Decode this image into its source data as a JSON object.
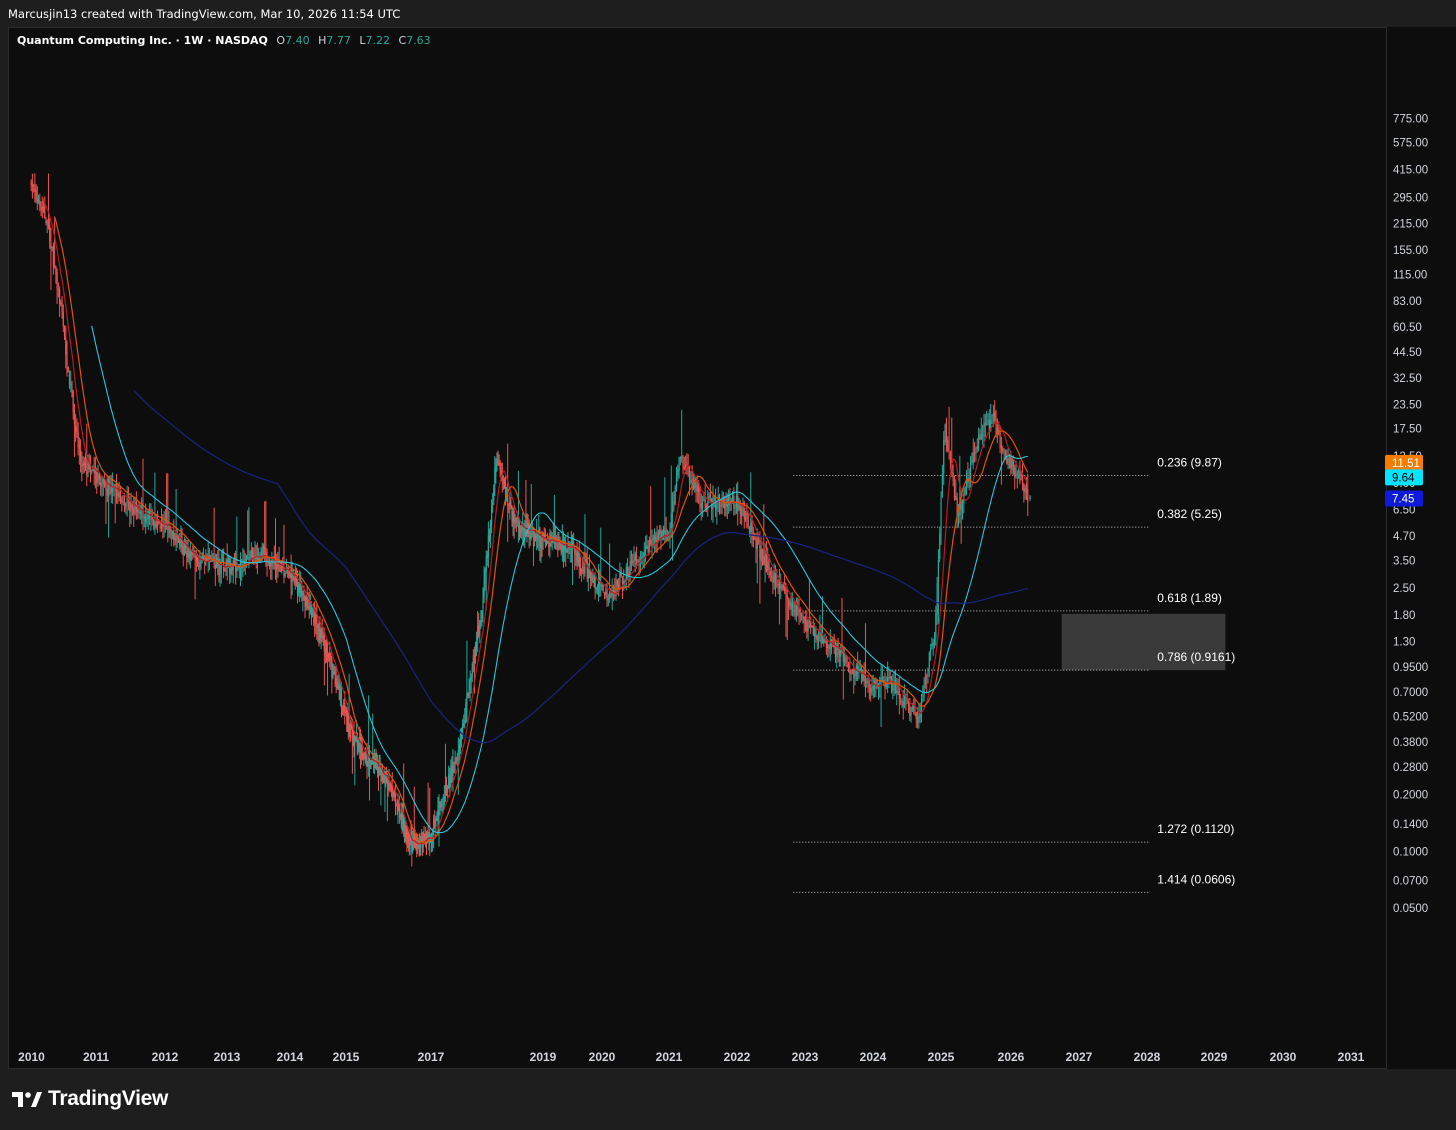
{
  "header": {
    "attribution": "Marcusjin13 created with TradingView.com, Mar 10, 2026 11:54 UTC"
  },
  "legend": {
    "symbol": "Quantum Computing Inc. · 1W · NASDAQ",
    "o_label": "O",
    "o_value": "7.40",
    "h_label": "H",
    "h_value": "7.77",
    "l_label": "L",
    "l_value": "7.22",
    "c_label": "C",
    "c_value": "7.63"
  },
  "brand": {
    "name": "TradingView",
    "logo_icon": "tradingview-logo-icon"
  },
  "colors": {
    "bull": "#26a69a",
    "bear": "#ef5350",
    "ma_fast": "#b71c1c",
    "ma_mid": "#e65100",
    "ma_slow": "#26c6da",
    "ma_long": "#1a237e",
    "badge_orange": "#f57c00",
    "badge_cyan": "#00e5ff",
    "badge_blue": "#0d1bd9"
  },
  "chart_data": {
    "type": "candlestick",
    "title": "Quantum Computing Inc. · 1W · NASDAQ",
    "interval": "1W",
    "y_scale": "log",
    "grid": false,
    "x_ticks": [
      "2010",
      "2011",
      "2012",
      "2013",
      "2014",
      "2015",
      "2017",
      "2019",
      "2020",
      "2021",
      "2022",
      "2023",
      "2024",
      "2025",
      "2026",
      "2027",
      "2028",
      "2029",
      "2030",
      "2031"
    ],
    "y_ticks": [
      "775.00",
      "575.00",
      "415.00",
      "295.00",
      "215.00",
      "155.00",
      "115.00",
      "83.00",
      "60.50",
      "44.50",
      "32.50",
      "23.50",
      "17.50",
      "12.50",
      "9.00",
      "6.50",
      "4.70",
      "3.50",
      "2.50",
      "1.80",
      "1.30",
      "0.9500",
      "0.7000",
      "0.5200",
      "0.3800",
      "0.2800",
      "0.2000",
      "0.1400",
      "0.1000",
      "0.0700",
      "0.0500"
    ],
    "last_ohlc": {
      "open": 7.4,
      "high": 7.77,
      "low": 7.22,
      "close": 7.63
    },
    "price_path": [
      [
        "2009-12-01",
        350
      ],
      [
        "2010-03-01",
        220
      ],
      [
        "2010-06-01",
        60
      ],
      [
        "2010-09-01",
        12
      ],
      [
        "2011-01-01",
        9
      ],
      [
        "2011-06-01",
        7
      ],
      [
        "2012-01-01",
        5
      ],
      [
        "2012-06-01",
        3.5
      ],
      [
        "2013-01-01",
        3.2
      ],
      [
        "2013-06-01",
        3.8
      ],
      [
        "2014-01-01",
        2.8
      ],
      [
        "2014-06-01",
        1.6
      ],
      [
        "2015-01-01",
        0.45
      ],
      [
        "2015-06-01",
        0.32
      ],
      [
        "2016-01-01",
        0.22
      ],
      [
        "2016-06-01",
        0.11
      ],
      [
        "2016-12-01",
        0.12
      ],
      [
        "2017-06-01",
        0.35
      ],
      [
        "2017-11-01",
        2.0
      ],
      [
        "2018-02-01",
        12
      ],
      [
        "2018-06-01",
        5.5
      ],
      [
        "2019-01-01",
        4.4
      ],
      [
        "2019-06-01",
        4.0
      ],
      [
        "2020-01-01",
        2.2
      ],
      [
        "2020-06-01",
        3.5
      ],
      [
        "2020-12-01",
        5.0
      ],
      [
        "2021-02-01",
        13
      ],
      [
        "2021-06-01",
        7.0
      ],
      [
        "2021-12-01",
        7.3
      ],
      [
        "2022-06-01",
        3.0
      ],
      [
        "2022-12-01",
        1.6
      ],
      [
        "2023-06-01",
        1.1
      ],
      [
        "2023-12-01",
        0.75
      ],
      [
        "2024-03-01",
        0.78
      ],
      [
        "2024-08-01",
        0.5
      ],
      [
        "2024-11-01",
        1.5
      ],
      [
        "2024-12-20",
        18
      ],
      [
        "2025-03-01",
        6.0
      ],
      [
        "2025-06-01",
        14
      ],
      [
        "2025-09-01",
        20
      ],
      [
        "2025-11-01",
        12
      ],
      [
        "2026-01-01",
        10.5
      ],
      [
        "2026-03-08",
        7.63
      ]
    ],
    "moving_averages": [
      {
        "color_key": "ma_fast",
        "last_value": null
      },
      {
        "color_key": "ma_mid",
        "last_value": 11.51
      },
      {
        "color_key": "ma_slow",
        "last_value": 9.64
      },
      {
        "color_key": "ma_long",
        "last_value": 7.45
      }
    ],
    "price_badges": [
      {
        "text": "11.51",
        "value": 11.51,
        "color_key": "badge_orange",
        "text_color": "#ffffff"
      },
      {
        "text": "9.64",
        "value": 9.64,
        "color_key": "badge_cyan",
        "text_color": "#000000"
      },
      {
        "text": "7.45",
        "value": 7.45,
        "color_key": "badge_blue",
        "text_color": "#ffffff"
      }
    ],
    "fib_levels": [
      {
        "label": "0.236 (9.87)",
        "value": 9.87
      },
      {
        "label": "0.382 (5.25)",
        "value": 5.25
      },
      {
        "label": "0.618 (1.89)",
        "value": 1.89
      },
      {
        "label": "0.786 (0.9161)",
        "value": 0.9161
      },
      {
        "label": "1.272 (0.1120)",
        "value": 0.112
      },
      {
        "label": "1.414 (0.0606)",
        "value": 0.0606
      }
    ],
    "fib_range": {
      "from": "2022-10-01",
      "to": "2027-12-15"
    },
    "zone": {
      "from": "2026-09-01",
      "to": "2029-02-01",
      "top": 1.89,
      "bottom": 0.9161
    }
  }
}
